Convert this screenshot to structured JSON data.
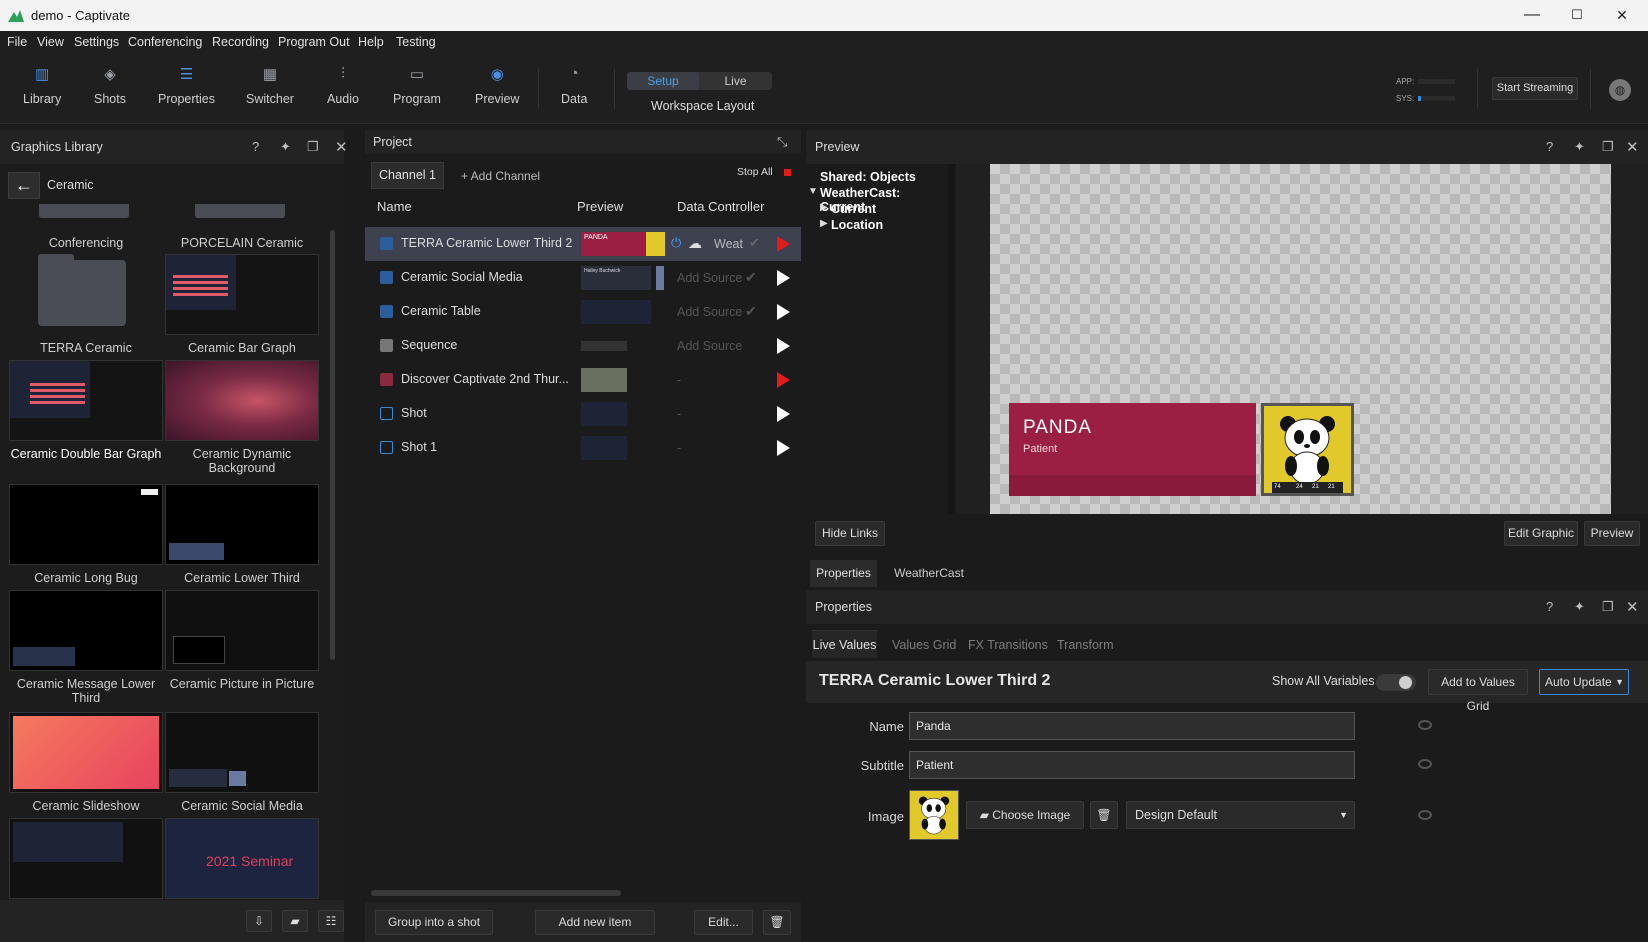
{
  "window": {
    "title": "demo - Captivate",
    "minimize": "—",
    "maximize": "☐",
    "close": "✕"
  },
  "menu": [
    "File",
    "View",
    "Settings",
    "Conferencing",
    "Recording",
    "Program Out",
    "Help",
    "Testing"
  ],
  "toolbar": {
    "items": [
      "Library",
      "Shots",
      "Properties",
      "Switcher",
      "Audio",
      "Program",
      "Preview",
      "Data"
    ],
    "mode_setup": "Setup",
    "mode_live": "Live",
    "workspace_label": "Workspace Layout",
    "app_label": "APP:",
    "sys_label": "SYS:",
    "start_streaming": "Start Streaming"
  },
  "library": {
    "title": "Graphics Library",
    "folder": "Ceramic",
    "tiles": [
      {
        "label": "Conferencing"
      },
      {
        "label": "PORCELAIN Ceramic"
      },
      {
        "label": "TERRA Ceramic"
      },
      {
        "label": "Ceramic Bar Graph"
      },
      {
        "label": "Ceramic Double Bar Graph"
      },
      {
        "label": "Ceramic Dynamic Background"
      },
      {
        "label": "Ceramic Long Bug"
      },
      {
        "label": "Ceramic Lower Third"
      },
      {
        "label": "Ceramic Message Lower Third"
      },
      {
        "label": "Ceramic Picture in Picture"
      },
      {
        "label": "Ceramic Slideshow"
      },
      {
        "label": "Ceramic Social Media"
      },
      {
        "label": ""
      },
      {
        "label": ""
      }
    ],
    "seminar_text": "2021 Seminar"
  },
  "project": {
    "title": "Project",
    "channel_tab": "Channel 1",
    "add_channel": "+ Add Channel",
    "stop_all": "Stop All",
    "columns": {
      "name": "Name",
      "preview": "Preview",
      "data": "Data Controller"
    },
    "rows": [
      {
        "name": "TERRA Ceramic Lower Third 2",
        "source": "Weat"
      },
      {
        "name": "Ceramic Social Media",
        "source": "Add Source"
      },
      {
        "name": "Ceramic Table",
        "source": "Add Source"
      },
      {
        "name": "Sequence",
        "source": "Add Source"
      },
      {
        "name": "Discover Captivate 2nd Thur...",
        "source": "-"
      },
      {
        "name": "Shot",
        "source": "-"
      },
      {
        "name": "Shot 1",
        "source": "-"
      }
    ],
    "thumb_panda": "PANDA",
    "thumb_hailey": "Hailey Buchwick",
    "btn_group": "Group into a shot",
    "btn_add": "Add new item",
    "btn_edit": "Edit..."
  },
  "preview": {
    "title": "Preview",
    "tree": {
      "root": "Shared: Objects",
      "group": "WeatherCast: Current",
      "children": [
        "Current",
        "Location"
      ]
    },
    "graphic_name": "PANDA",
    "graphic_sub": "Patient",
    "panda_nums": [
      "74",
      "24",
      "21",
      "21"
    ],
    "hide_links": "Hide Links",
    "edit_graphic": "Edit Graphic",
    "preview_btn": "Preview"
  },
  "tabs": [
    "Properties",
    "WeatherCast"
  ],
  "properties": {
    "title": "Properties",
    "subtabs": [
      "Live Values",
      "Values Grid",
      "FX Transitions",
      "Transform"
    ],
    "graphic_title": "TERRA Ceramic Lower Third 2",
    "show_all": "Show All Variables",
    "add_grid": "Add to Values Grid",
    "auto_update": "Auto Update",
    "fields": {
      "name_label": "Name",
      "name_value": "Panda",
      "subtitle_label": "Subtitle",
      "subtitle_value": "Patient",
      "image_label": "Image"
    },
    "choose_image": "Choose Image",
    "design_default": "Design Default"
  },
  "colors": {
    "accent": "#3a8bd6",
    "crimson": "#9b1e43",
    "play_red": "#e21b1b"
  }
}
